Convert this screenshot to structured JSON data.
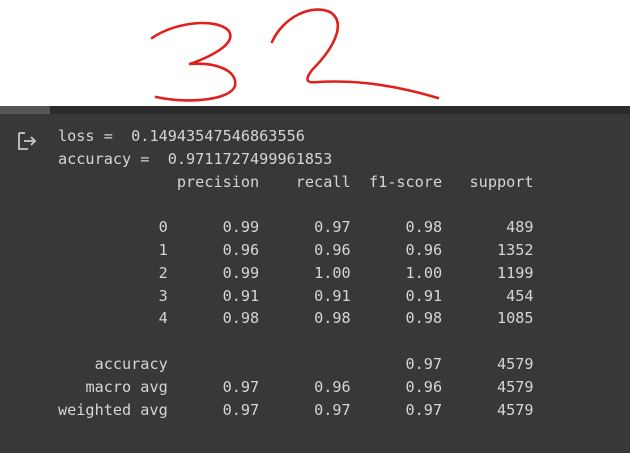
{
  "annotation": {
    "handwritten_text": "32",
    "ink_color": "#e0201c"
  },
  "output": {
    "icon": "output-clear-icon",
    "loss_label": "loss",
    "loss_value": "0.14943547546863556",
    "accuracy_label": "accuracy",
    "accuracy_value": "0.9711727499961853",
    "report": {
      "columns": [
        "precision",
        "recall",
        "f1-score",
        "support"
      ],
      "rows": [
        {
          "label": "0",
          "precision": "0.99",
          "recall": "0.97",
          "f1": "0.98",
          "support": "489"
        },
        {
          "label": "1",
          "precision": "0.96",
          "recall": "0.96",
          "f1": "0.96",
          "support": "1352"
        },
        {
          "label": "2",
          "precision": "0.99",
          "recall": "1.00",
          "f1": "1.00",
          "support": "1199"
        },
        {
          "label": "3",
          "precision": "0.91",
          "recall": "0.91",
          "f1": "0.91",
          "support": "454"
        },
        {
          "label": "4",
          "precision": "0.98",
          "recall": "0.98",
          "f1": "0.98",
          "support": "1085"
        }
      ],
      "summary": [
        {
          "label": "accuracy",
          "precision": "",
          "recall": "",
          "f1": "0.97",
          "support": "4579"
        },
        {
          "label": "macro avg",
          "precision": "0.97",
          "recall": "0.96",
          "f1": "0.96",
          "support": "4579"
        },
        {
          "label": "weighted avg",
          "precision": "0.97",
          "recall": "0.97",
          "f1": "0.97",
          "support": "4579"
        }
      ]
    }
  },
  "colors": {
    "output_background": "#383838",
    "output_text": "#d5d5d5",
    "page_background": "#ffffff"
  }
}
